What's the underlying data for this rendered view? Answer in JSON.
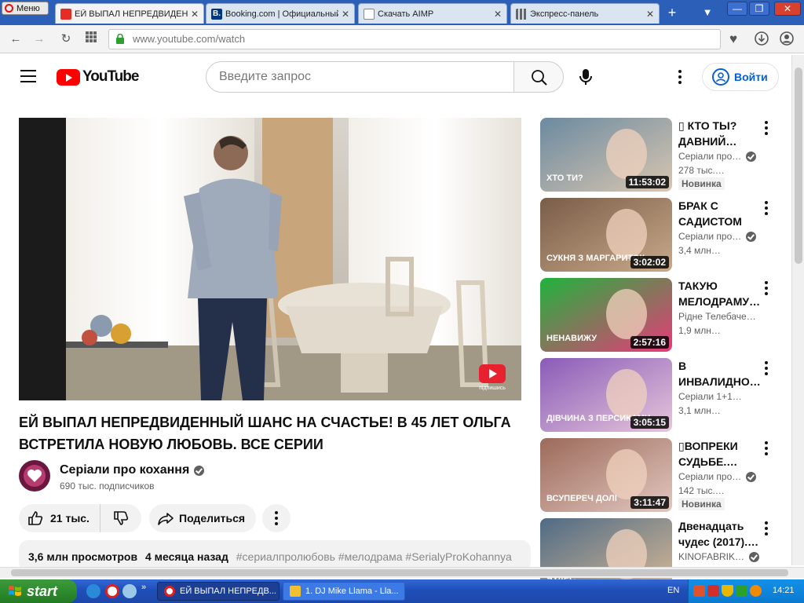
{
  "browser": {
    "menu_label": "Меню",
    "tabs": [
      {
        "title": "ЕЙ ВЫПАЛ НЕПРЕДВИДЕННЫЙ",
        "active": true
      },
      {
        "title": "Booking.com | Официальный",
        "active": false
      },
      {
        "title": "Скачать AIMP",
        "active": false
      },
      {
        "title": "Экспресс-панель",
        "active": false
      }
    ],
    "url": "www.youtube.com/watch"
  },
  "youtube": {
    "logo_text": "YouTube",
    "search_placeholder": "Введите запрос",
    "signin_label": "Войти"
  },
  "video": {
    "title": "ЕЙ ВЫПАЛ НЕПРЕДВИДЕННЫЙ ШАНС НА СЧАСТЬЕ! В 45 ЛЕТ ОЛЬГА ВСТРЕТИЛА НОВУЮ ЛЮБОВЬ. ВСЕ СЕРИИ",
    "subscribe_badge": "підпишись",
    "channel_name": "Серіали про кохання",
    "subscribers": "690 тыс. подписчиков",
    "likes": "21 тыс.",
    "share_label": "Поделиться",
    "views": "3,6 млн просмотров",
    "uploaded": "4 месяца назад",
    "hashtags": "#сериалпролюбовь #мелодрама #SerialyProKohannya"
  },
  "recommendations": [
    {
      "title": "▯ КТО ТЫ? ДАВНИЙ…",
      "channel": "Серіали про…",
      "verified": true,
      "views": "278 тыс.…",
      "badge": "Новинка",
      "duration": "11:53:02",
      "thumb_text": "ХТО ТИ?",
      "colors": [
        "#6b8aa0",
        "#d9c6b0"
      ]
    },
    {
      "title": "БРАК С САДИСТОМ И…",
      "channel": "Серіали про…",
      "verified": true,
      "views": "3,4 млн…",
      "badge": "",
      "duration": "3:02:02",
      "thumb_text": "СУКНЯ З МАРГАРИТОК",
      "colors": [
        "#7a5d48",
        "#c9a98a"
      ]
    },
    {
      "title": "ТАКУЮ МЕЛОДРАМУ…",
      "channel": "Рідне Телебачен…",
      "verified": false,
      "views": "1,9 млн…",
      "badge": "",
      "duration": "2:57:16",
      "thumb_text": "НЕНАВИЖУ",
      "colors": [
        "#1fb33c",
        "#e83a7a"
      ]
    },
    {
      "title": "В ИНВАЛИДНО…",
      "channel": "Серіали 1+1…",
      "verified": false,
      "views": "3,1 млн…",
      "badge": "",
      "duration": "3:05:15",
      "thumb_text": "ДІВЧИНА З ПЕРСИКАМИ",
      "colors": [
        "#8a5bb8",
        "#e6c6da"
      ]
    },
    {
      "title": "▯ВОПРЕКИ СУДЬБЕ.…",
      "channel": "Серіали про…",
      "verified": true,
      "views": "142 тыс.…",
      "badge": "Новинка",
      "duration": "3:11:47",
      "thumb_text": "ВСУПЕРЕЧ ДОЛІ",
      "colors": [
        "#9c6a5a",
        "#e2c7c0"
      ]
    },
    {
      "title": "Двенадцать чудес (2017).…",
      "channel": "KINOFABRIK…",
      "verified": true,
      "views": "",
      "badge": "",
      "duration": "",
      "thumb_text": "ЧУДЕС",
      "colors": [
        "#4f6b85",
        "#d7b995"
      ]
    }
  ],
  "taskbar": {
    "start_label": "start",
    "tasks": [
      {
        "title": "ЕЙ ВЫПАЛ НЕПРЕДВ...",
        "active": true
      },
      {
        "title": "1. DJ Mike Llama - Lla...",
        "active": false
      }
    ],
    "language": "EN",
    "clock": "14:21"
  },
  "colors": {
    "yt_red": "#ff0000",
    "link_blue": "#065fd4",
    "xp_blue": "#2b5fb8",
    "xp_green": "#2e8b2e"
  }
}
